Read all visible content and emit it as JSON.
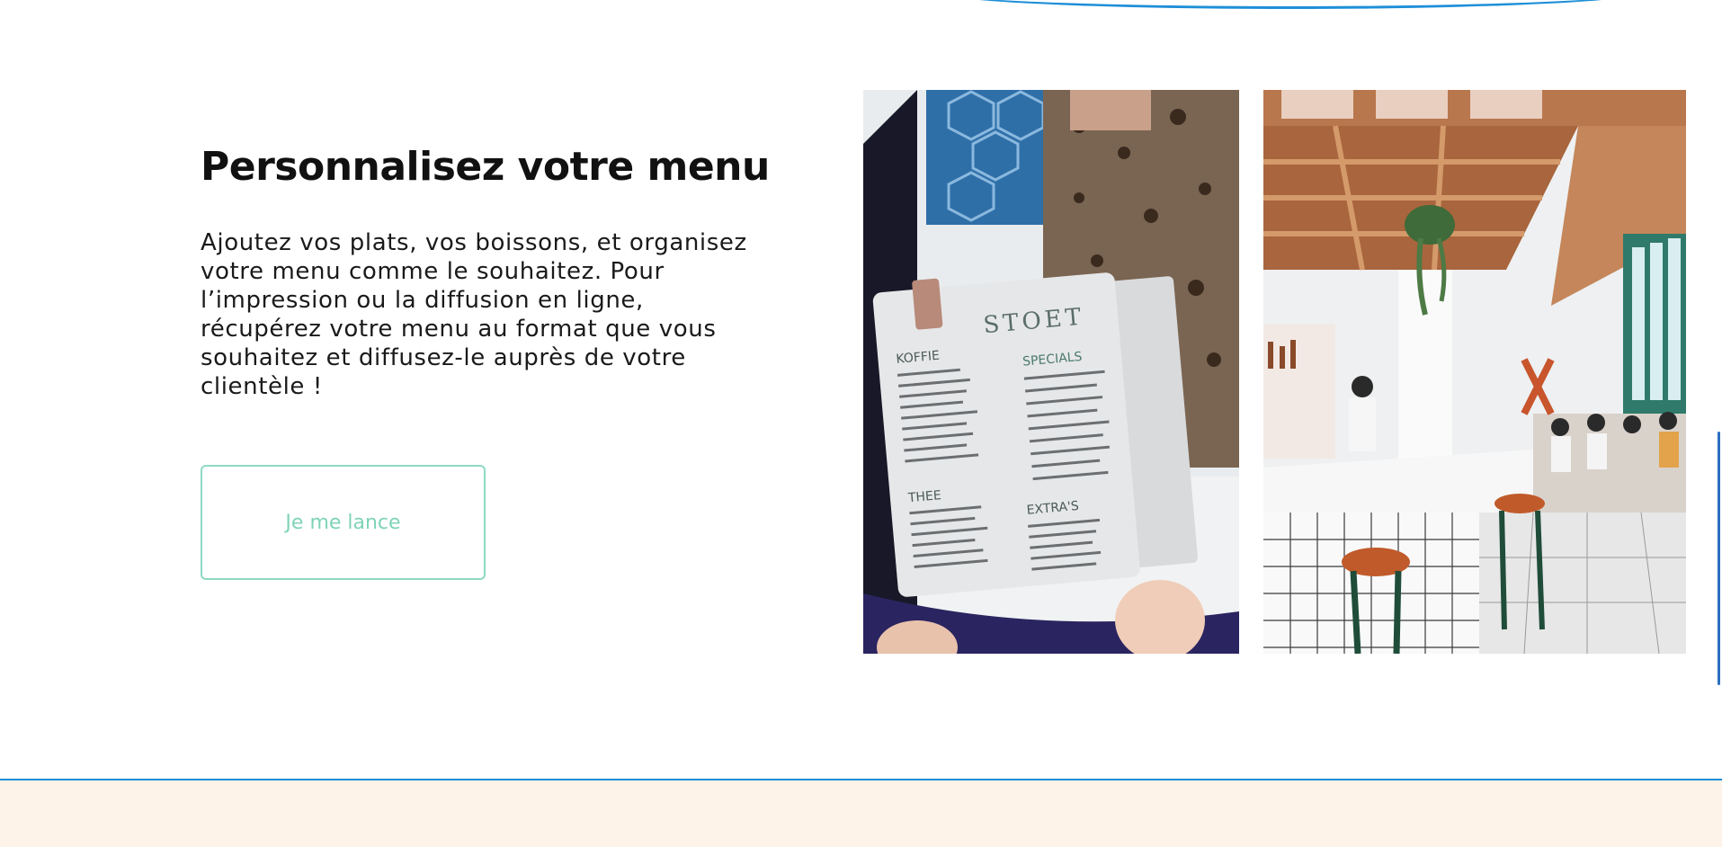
{
  "section": {
    "title": "Personnalisez votre menu",
    "body": "Ajoutez vos plats, vos boissons, et organisez votre menu comme le souhaitez. Pour l’impression ou la diffusion en ligne, récupérez votre menu au format que vous souhaitez et diffusez-le auprès de votre clientèle !",
    "cta_label": "Je me lance"
  },
  "menu_card": {
    "brand": "STOET",
    "sections": [
      "KOFFIE",
      "SPECIALS",
      "THEE",
      "EXTRA'S"
    ]
  },
  "colors": {
    "accent_blue": "#1e8fd8",
    "button_green": "#7fd3b8",
    "bottom_band": "#fdf3e8"
  }
}
